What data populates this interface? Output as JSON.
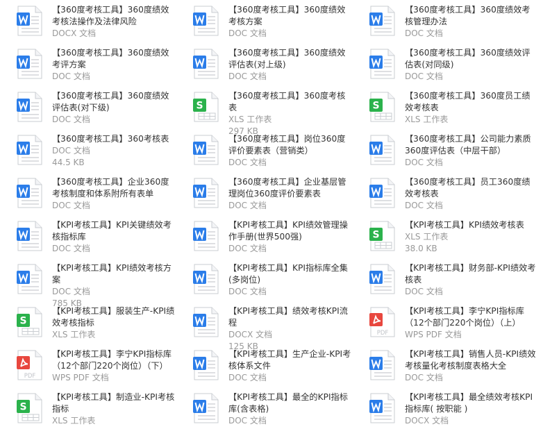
{
  "colors": {
    "word_blue": "#2b7de9",
    "excel_green": "#2bb24c",
    "pdf_red": "#e8473e",
    "page_border": "#c9ccd1"
  },
  "files": [
    {
      "title": "【360度考核工具】360度绩效考核法操作及法律风险",
      "type": "DOCX 文档",
      "size": "",
      "icon": "word-icon"
    },
    {
      "title": "【360度考核工具】360度绩效考核方案",
      "type": "DOC 文档",
      "size": "",
      "icon": "word-icon"
    },
    {
      "title": "【360度考核工具】360度绩效考核管理办法",
      "type": "DOC 文档",
      "size": "",
      "icon": "word-icon"
    },
    {
      "title": "【360度考核工具】360度绩效考评方案",
      "type": "DOC 文档",
      "size": "",
      "icon": "word-icon"
    },
    {
      "title": "【360度考核工具】360度绩效评估表(对上级)",
      "type": "DOC 文档",
      "size": "",
      "icon": "word-icon"
    },
    {
      "title": "【360度考核工具】360度绩效评估表(对同级)",
      "type": "DOC 文档",
      "size": "",
      "icon": "word-icon"
    },
    {
      "title": "【360度考核工具】360度绩效评估表(对下级)",
      "type": "DOC 文档",
      "size": "",
      "icon": "word-icon"
    },
    {
      "title": "【360度考核工具】360度考核表",
      "type": "XLS 工作表",
      "size": "297 KB",
      "icon": "excel-icon"
    },
    {
      "title": "【360度考核工具】360度员工绩效考核表",
      "type": "XLS 工作表",
      "size": "",
      "icon": "excel-icon"
    },
    {
      "title": "【360度考核工具】360考核表",
      "type": "DOC 文档",
      "size": "44.5 KB",
      "icon": "word-icon"
    },
    {
      "title": "【360度考核工具】岗位360度评价要素表（营销类）",
      "type": "DOC 文档",
      "size": "",
      "icon": "word-icon"
    },
    {
      "title": "【360度考核工具】公司能力素质360度评估表（中层干部）",
      "type": "DOC 文档",
      "size": "",
      "icon": "word-icon"
    },
    {
      "title": "【360度考核工具】企业360度考核制度和体系附所有表单",
      "type": "DOC 文档",
      "size": "",
      "icon": "word-icon"
    },
    {
      "title": "【360度考核工具】企业基层管理岗位360度评价要素表",
      "type": "DOC 文档",
      "size": "",
      "icon": "word-icon"
    },
    {
      "title": "【360度考核工具】员工360度绩效考核表",
      "type": "DOC 文档",
      "size": "",
      "icon": "word-icon"
    },
    {
      "title": "【KPI考核工具】KPI关键绩效考核指标库",
      "type": "DOC 文档",
      "size": "",
      "icon": "word-icon"
    },
    {
      "title": "【KPI考核工具】KPI绩效管理操作手册(世界500强)",
      "type": "DOC 文档",
      "size": "",
      "icon": "word-icon"
    },
    {
      "title": "【KPI考核工具】KPI绩效考核表",
      "type": "XLS 工作表",
      "size": "38.0 KB",
      "icon": "excel-icon"
    },
    {
      "title": "【KPI考核工具】KPI绩效考核方案",
      "type": "DOC 文档",
      "size": "785 KB",
      "icon": "word-icon"
    },
    {
      "title": "【KPI考核工具】KPI指标库全集(多岗位)",
      "type": "DOC 文档",
      "size": "",
      "icon": "word-icon"
    },
    {
      "title": "【KPI考核工具】财务部-KPI绩效考核表",
      "type": "DOC 文档",
      "size": "",
      "icon": "word-icon"
    },
    {
      "title": "【KPI考核工具】服装生产-KPI绩效考核指标",
      "type": "XLS 工作表",
      "size": "",
      "icon": "excel-icon"
    },
    {
      "title": "【KPI考核工具】绩效考核KPI流程",
      "type": "DOCX 文档",
      "size": "125 KB",
      "icon": "word-icon"
    },
    {
      "title": "【KPI考核工具】李宁KPI指标库（12个部门220个岗位）（上）",
      "type": "WPS PDF 文档",
      "size": "",
      "icon": "pdf-icon"
    },
    {
      "title": "【KPI考核工具】李宁KPI指标库（12个部门220个岗位）（下）",
      "type": "WPS PDF 文档",
      "size": "",
      "icon": "pdf-icon"
    },
    {
      "title": "【KPI考核工具】生产企业-KPI考核体系文件",
      "type": "DOC 文档",
      "size": "",
      "icon": "word-icon"
    },
    {
      "title": "【KPI考核工具】销售人员-KPI绩效考核量化考核制度表格大全",
      "type": "DOC 文档",
      "size": "",
      "icon": "word-icon"
    },
    {
      "title": "【KPI考核工具】制造业-KPI考核指标",
      "type": "XLS 工作表",
      "size": "",
      "icon": "excel-icon"
    },
    {
      "title": "【KPI考核工具】最全的KPI指标库(含表格)",
      "type": "DOC 文档",
      "size": "",
      "icon": "word-icon"
    },
    {
      "title": "【KPI考核工具】最全绩效考核KPI指标库( 按职能 )",
      "type": "DOCX 文档",
      "size": "",
      "icon": "word-icon"
    }
  ]
}
